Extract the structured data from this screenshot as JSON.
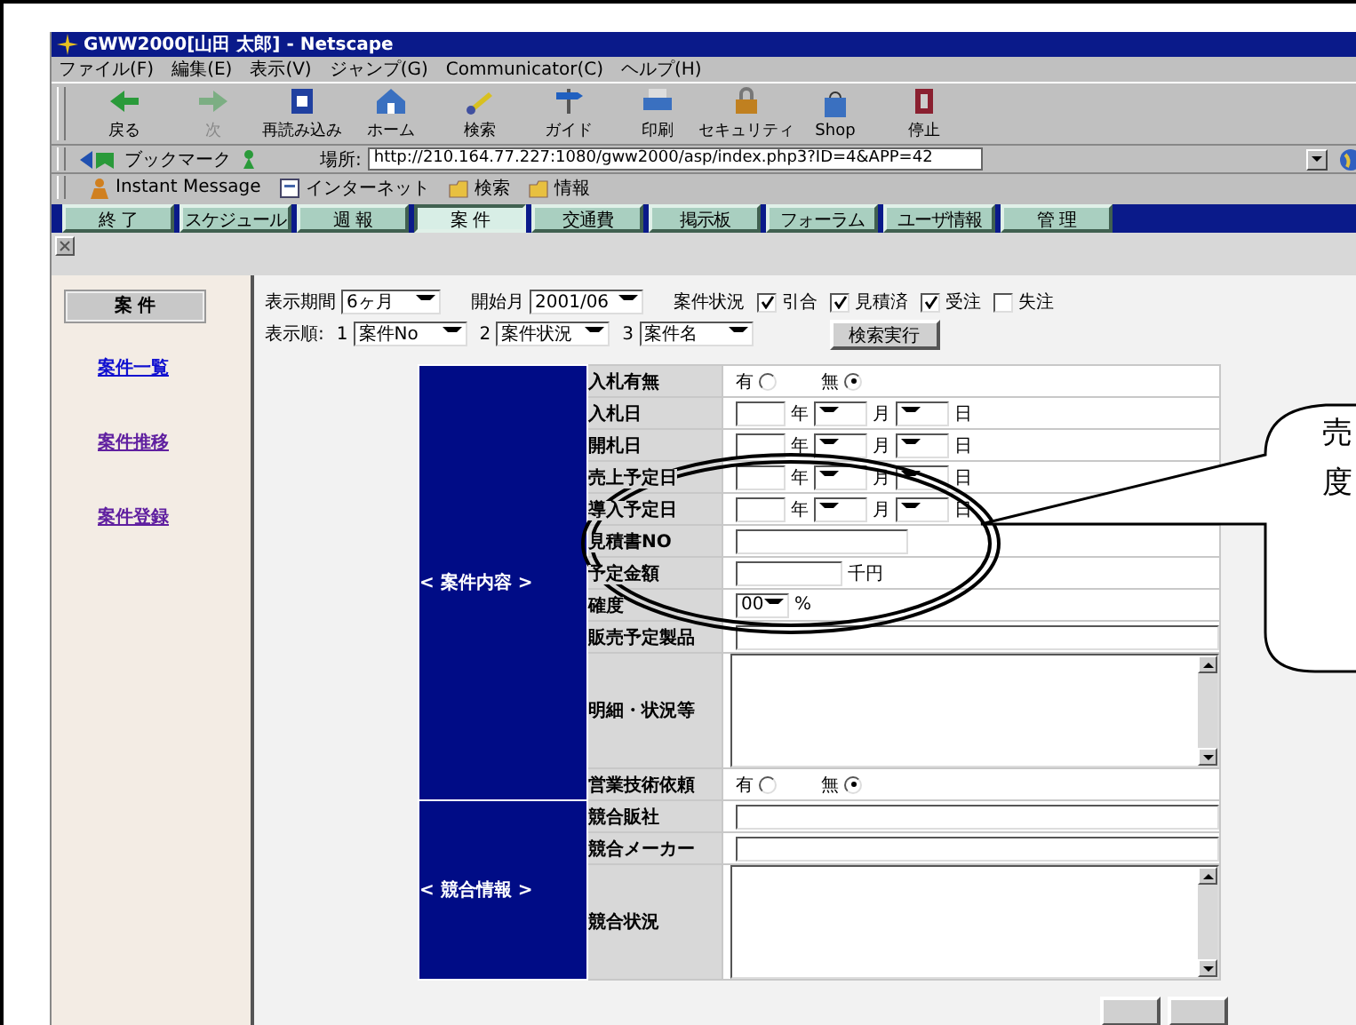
{
  "window": {
    "title": "GWW2000[山田 太郎] - Netscape"
  },
  "menu": [
    "ファイル(F)",
    "編集(E)",
    "表示(V)",
    "ジャンプ(G)",
    "Communicator(C)",
    "ヘルプ(H)"
  ],
  "toolbar": [
    {
      "label": "戻る",
      "kind": "back",
      "disabled": false
    },
    {
      "label": "次",
      "kind": "forward",
      "disabled": true
    },
    {
      "label": "再読み込み",
      "kind": "reload",
      "disabled": false
    },
    {
      "label": "ホーム",
      "kind": "home",
      "disabled": false
    },
    {
      "label": "検索",
      "kind": "search",
      "disabled": false
    },
    {
      "label": "ガイド",
      "kind": "guide",
      "disabled": false
    },
    {
      "label": "印刷",
      "kind": "print",
      "disabled": false
    },
    {
      "label": "セキュリティ",
      "kind": "security",
      "disabled": false
    },
    {
      "label": "Shop",
      "kind": "shop",
      "disabled": false
    },
    {
      "label": "停止",
      "kind": "stop",
      "disabled": false
    }
  ],
  "location": {
    "bookmarks": "ブックマーク",
    "label": "場所:",
    "url": "http://210.164.77.227:1080/gww2000/asp/index.php3?ID=4&APP=42"
  },
  "personal_bar": [
    {
      "label": "Instant Message",
      "kind": "person"
    },
    {
      "label": "インターネット",
      "kind": "page"
    },
    {
      "label": "検索",
      "kind": "folder"
    },
    {
      "label": "情報",
      "kind": "folder"
    }
  ],
  "nav_tabs": [
    {
      "label": "終 了",
      "selected": false
    },
    {
      "label": "スケジュール",
      "selected": false
    },
    {
      "label": "週 報",
      "selected": false
    },
    {
      "label": "案 件",
      "selected": true
    },
    {
      "label": "交通費",
      "selected": false
    },
    {
      "label": "掲示板",
      "selected": false
    },
    {
      "label": "フォーラム",
      "selected": false
    },
    {
      "label": "ユーザ情報",
      "selected": false
    },
    {
      "label": "管 理",
      "selected": false
    }
  ],
  "sidebar": {
    "title": "案 件",
    "links": [
      {
        "label": "案件一覧",
        "visited": false
      },
      {
        "label": "案件推移",
        "visited": true
      },
      {
        "label": "案件登録",
        "visited": true
      }
    ]
  },
  "filters": {
    "period": {
      "label": "表示期間",
      "value": "6ヶ月"
    },
    "start": {
      "label": "開始月",
      "value": "2001/06"
    },
    "status": {
      "label": "案件状況",
      "options": [
        {
          "label": "引合",
          "checked": true
        },
        {
          "label": "見積済",
          "checked": true
        },
        {
          "label": "受注",
          "checked": true
        },
        {
          "label": "失注",
          "checked": false
        }
      ]
    },
    "order": {
      "label": "表示順:",
      "keys": [
        {
          "num": "1",
          "value": "案件No"
        },
        {
          "num": "2",
          "value": "案件状況"
        },
        {
          "num": "3",
          "value": "案件名"
        }
      ]
    },
    "search_button": "検索実行"
  },
  "form": {
    "sections": [
      {
        "title": "< 案件内容 >",
        "rows": [
          {
            "label": "入札有無",
            "kind": "radio",
            "options": [
              {
                "label": "有",
                "selected": false
              },
              {
                "label": "無",
                "selected": true
              }
            ]
          },
          {
            "label": "入札日",
            "kind": "date",
            "units": [
              "年",
              "月",
              "日"
            ]
          },
          {
            "label": "開札日",
            "kind": "date",
            "units": [
              "年",
              "月",
              "日"
            ]
          },
          {
            "label": "売上予定日",
            "kind": "date",
            "units": [
              "年",
              "月",
              "日"
            ]
          },
          {
            "label": "導入予定日",
            "kind": "date",
            "units": [
              "年",
              "月",
              "日"
            ]
          },
          {
            "label": "見積書NO",
            "kind": "shorttext"
          },
          {
            "label": "予定金額",
            "kind": "amount",
            "unit": "千円"
          },
          {
            "label": "確度",
            "kind": "select",
            "value": "00",
            "unit": "%"
          },
          {
            "label": "販売予定製品",
            "kind": "text"
          },
          {
            "label": "明細・状況等",
            "kind": "textarea"
          },
          {
            "label": "営業技術依頼",
            "kind": "radio",
            "options": [
              {
                "label": "有",
                "selected": false
              },
              {
                "label": "無",
                "selected": true
              }
            ]
          }
        ]
      },
      {
        "title": "< 競合情報 >",
        "rows": [
          {
            "label": "競合販社",
            "kind": "text"
          },
          {
            "label": "競合メーカー",
            "kind": "text"
          },
          {
            "label": "競合状況",
            "kind": "textarea"
          }
        ]
      }
    ]
  },
  "callout": {
    "lines": [
      "売",
      "度"
    ]
  }
}
